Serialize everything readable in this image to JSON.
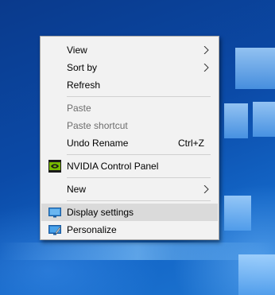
{
  "menu": {
    "items": [
      {
        "label": "View",
        "has_submenu": true
      },
      {
        "label": "Sort by",
        "has_submenu": true
      },
      {
        "label": "Refresh"
      },
      {
        "label": "Paste",
        "disabled": true
      },
      {
        "label": "Paste shortcut",
        "disabled": true
      },
      {
        "label": "Undo Rename",
        "shortcut": "Ctrl+Z"
      },
      {
        "label": "NVIDIA Control Panel",
        "icon": "nvidia-icon"
      },
      {
        "label": "New",
        "has_submenu": true
      },
      {
        "label": "Display settings",
        "icon": "display-icon",
        "highlighted": true
      },
      {
        "label": "Personalize",
        "icon": "personalize-icon"
      }
    ]
  },
  "colors": {
    "menu_bg": "#f2f2f2",
    "highlight": "#dadada",
    "disabled_text": "#6d6d6d",
    "desktop_blue": "#0b4aa7"
  }
}
